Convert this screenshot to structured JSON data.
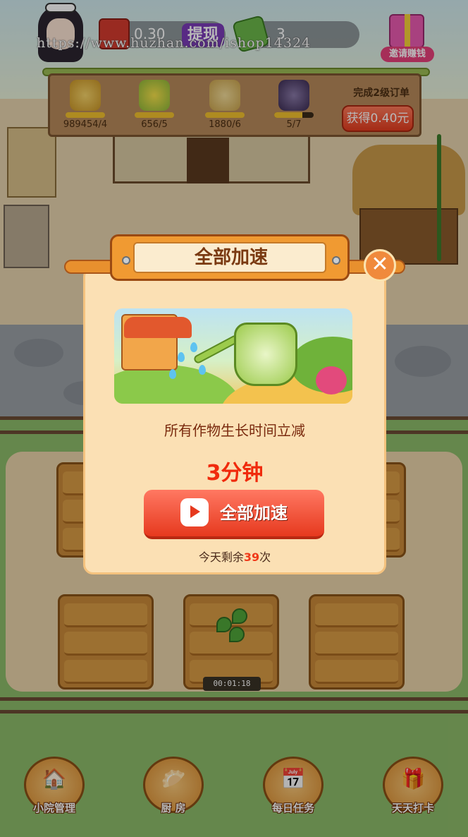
{
  "hud": {
    "cash_value": "0.30",
    "withdraw_label": "提现",
    "money_value": "3",
    "invite_label": "邀请赚钱",
    "watermark": "https://www.huzhan.com/ishop14324"
  },
  "order_board": {
    "crops": [
      {
        "name": "wheat-icon",
        "count": "989454/4",
        "progress": 1.0
      },
      {
        "name": "corn-icon",
        "count": "656/5",
        "progress": 1.0
      },
      {
        "name": "rice-icon",
        "count": "1880/6",
        "progress": 1.0
      },
      {
        "name": "eggplant-icon",
        "count": "5/7",
        "progress": 0.71
      }
    ],
    "title": "完成2级订单",
    "reward_button": "获得0.40元"
  },
  "dialog": {
    "title": "全部加速",
    "description": "所有作物生长时间立减",
    "amount": "3分钟",
    "button_label": "全部加速",
    "remaining_prefix": "今天剩余",
    "remaining_count": "39",
    "remaining_suffix": "次",
    "close_symbol": "✕"
  },
  "farm": {
    "timer": "00:01:18"
  },
  "bottom_nav": [
    {
      "label": "小院管理",
      "icon": "house-icon"
    },
    {
      "label": "厨 房",
      "icon": "steamer-icon"
    },
    {
      "label": "每日任务",
      "icon": "calendar-icon"
    },
    {
      "label": "天天打卡",
      "icon": "gift-icon"
    }
  ],
  "colors": {
    "accent": "#e6391e",
    "dialog_bg": "#fbe0b4",
    "amount": "#f02a0c"
  }
}
